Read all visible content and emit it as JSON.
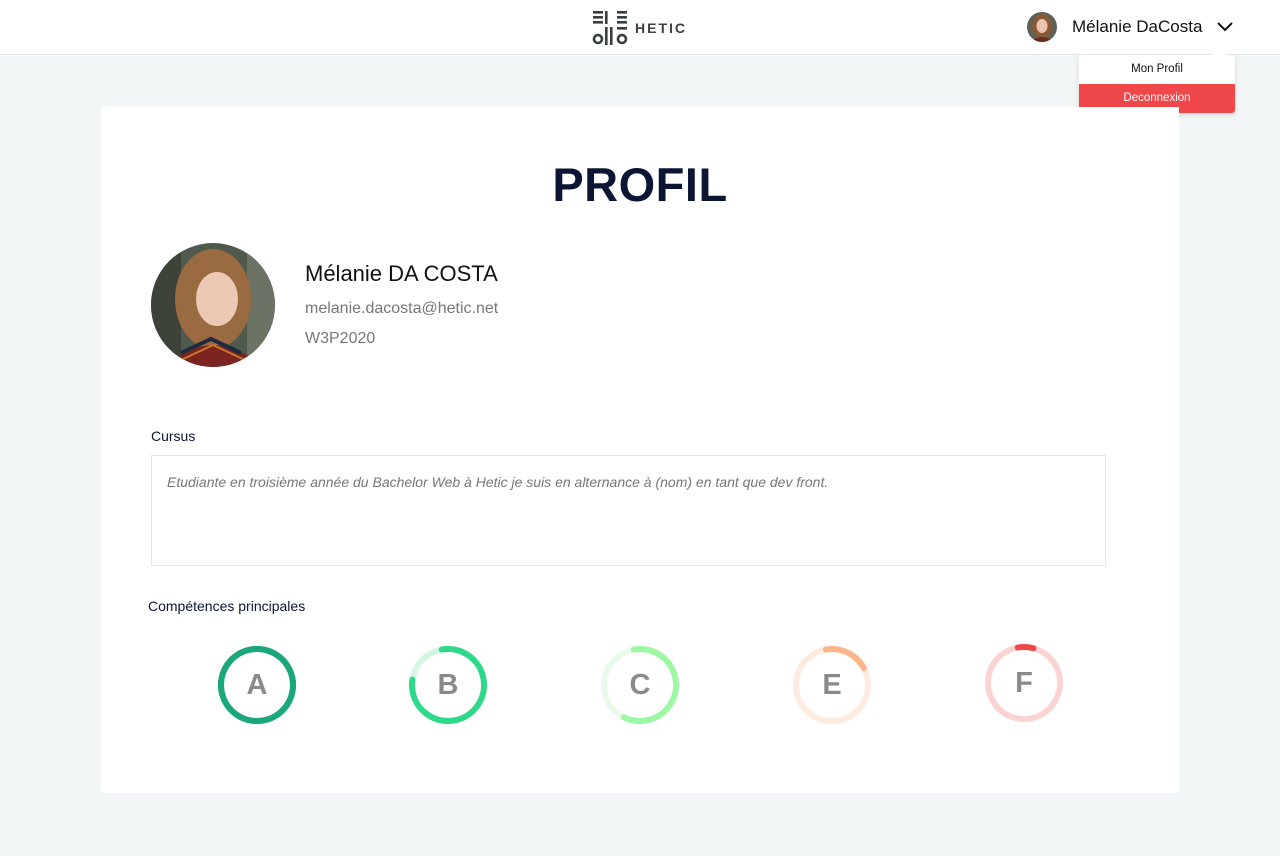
{
  "header": {
    "logo_text": "HETIC",
    "user_name": "Mélanie DaCosta"
  },
  "dropdown": {
    "profile_label": "Mon Profil",
    "logout_label": "Deconnexion"
  },
  "profile": {
    "title": "PROFIL",
    "full_name": "Mélanie DA COSTA",
    "email": "melanie.dacosta@hetic.net",
    "promo": "W3P2020",
    "cursus_label": "Cursus",
    "cursus_text": "Etudiante en troisième année du Bachelor Web à Hetic je suis en alternance à (nom) en tant que dev front."
  },
  "skills": {
    "label": "Compétences principales",
    "items": [
      {
        "letter": "A",
        "fill": 1.0,
        "color": "#1ba67b",
        "track": "#1ba67b"
      },
      {
        "letter": "B",
        "fill": 0.8,
        "color": "#2fd98a",
        "track": "#d3f5e4"
      },
      {
        "letter": "C",
        "fill": 0.6,
        "color": "#9ef7a3",
        "track": "#e8fbea"
      },
      {
        "letter": "E",
        "fill": 0.2,
        "color": "#fdb68a",
        "track": "#feebdf"
      },
      {
        "letter": "F",
        "fill": 0.07,
        "color": "#f0474a",
        "track": "#fbd3d3"
      }
    ]
  }
}
